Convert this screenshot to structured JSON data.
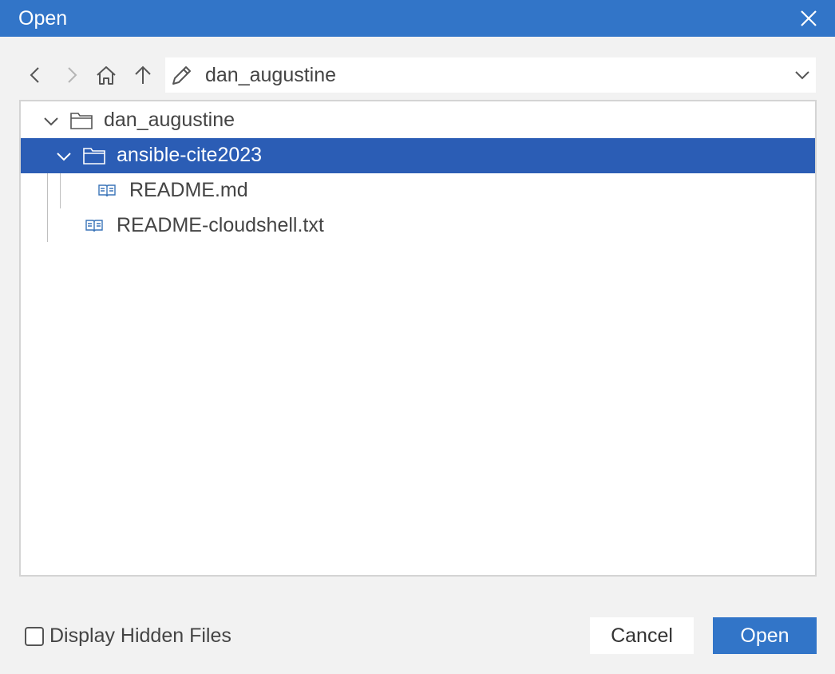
{
  "dialog": {
    "title": "Open"
  },
  "navbar": {
    "path": "dan_augustine"
  },
  "tree": {
    "items": [
      {
        "label": "dan_augustine",
        "type": "folder",
        "expanded": true,
        "selected": false
      },
      {
        "label": "ansible-cite2023",
        "type": "folder",
        "expanded": true,
        "selected": true
      },
      {
        "label": "README.md",
        "type": "file",
        "selected": false
      },
      {
        "label": "README-cloudshell.txt",
        "type": "file",
        "selected": false
      }
    ]
  },
  "footer": {
    "hidden_files_label": "Display Hidden Files",
    "hidden_files_checked": false,
    "cancel_label": "Cancel",
    "open_label": "Open"
  },
  "colors": {
    "titlebar": "#3275c8",
    "selection": "#2b5db5",
    "primary_button": "#3275c8"
  }
}
